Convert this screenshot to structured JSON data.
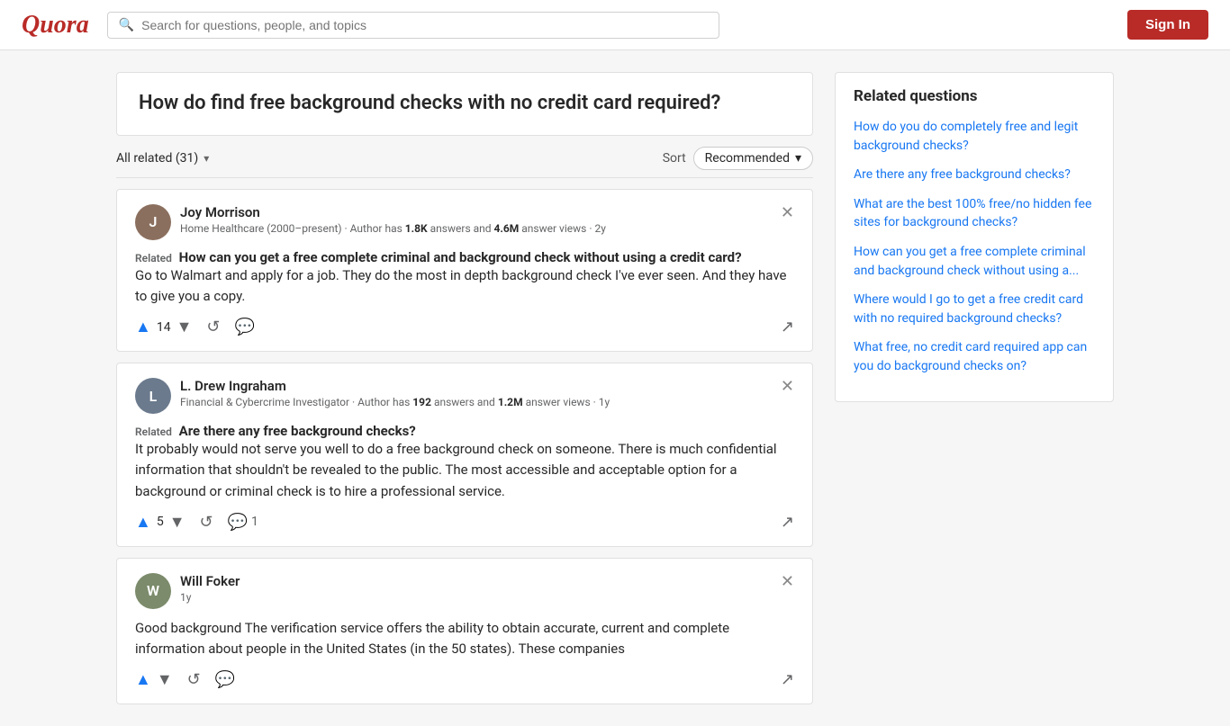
{
  "header": {
    "logo": "Quora",
    "search_placeholder": "Search for questions, people, and topics",
    "sign_in_label": "Sign In"
  },
  "main": {
    "question": {
      "title": "How do find free background checks with no credit card required?"
    },
    "answers_bar": {
      "all_related": "All related (31)",
      "sort_label": "Sort",
      "recommended_label": "Recommended"
    },
    "answers": [
      {
        "id": "joy-morrison",
        "author_name": "Joy Morrison",
        "author_meta": "Home Healthcare (2000–present) · Author has",
        "answers_count": "1.8K",
        "answer_views": "4.6M",
        "time_ago": "2y",
        "related_label": "Related",
        "related_question": "How can you get a free complete criminal and background check without using a credit card?",
        "answer_text": "Go to Walmart and apply for a job. They do the most in depth background check I've ever seen. And they have to give you a copy.",
        "upvotes": "14",
        "comments": "",
        "avatar_letter": "J",
        "avatar_class": "joy"
      },
      {
        "id": "drew-ingraham",
        "author_name": "L. Drew Ingraham",
        "author_meta": "Financial & Cybercrime Investigator · Author has",
        "answers_count": "192",
        "answer_views": "1.2M",
        "time_ago": "1y",
        "related_label": "Related",
        "related_question": "Are there any free background checks?",
        "answer_text": "It probably would not serve you well to do a free background check on someone. There is much confidential information that shouldn't be revealed to the public. The most accessible and acceptable option for a background or criminal check is to hire a professional service.",
        "upvotes": "5",
        "comments": "1",
        "avatar_letter": "L",
        "avatar_class": "drew"
      },
      {
        "id": "will-foker",
        "author_name": "Will Foker",
        "author_meta": "",
        "answers_count": "",
        "answer_views": "",
        "time_ago": "1y",
        "related_label": "",
        "related_question": "",
        "answer_text": "Good background The verification service offers the ability to obtain accurate, current and complete information about people in the United States (in the 50 states). These companies",
        "upvotes": "",
        "comments": "",
        "avatar_letter": "W",
        "avatar_class": "will"
      }
    ]
  },
  "sidebar": {
    "related_title": "Related questions",
    "related_questions": [
      "How do you do completely free and legit background checks?",
      "Are there any free background checks?",
      "What are the best 100% free/no hidden fee sites for background checks?",
      "How can you get a free complete criminal and background check without using a...",
      "Where would I go to get a free credit card with no required background checks?",
      "What free, no credit card required app can you do background checks on?"
    ]
  }
}
